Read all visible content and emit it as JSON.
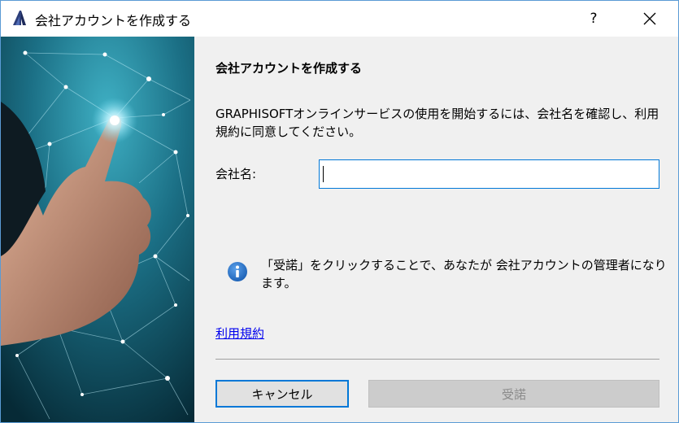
{
  "window": {
    "title": "会社アカウントを作成する",
    "help_label": "?",
    "close_label": "×"
  },
  "dialog": {
    "heading": "会社アカウントを作成する",
    "description": "GRAPHISOFTオンラインサービスの使用を開始するには、会社名を確認し、利用規約に同意してください。",
    "company_label": "会社名:",
    "company_value": "",
    "info_text": "「受諾」をクリックすることで、あなたが 会社アカウントの管理者になります。",
    "terms_link": "利用規約",
    "cancel_label": "キャンセル",
    "accept_label": "受諾"
  },
  "colors": {
    "accent": "#0078d7",
    "info_blue": "#1a5fb4",
    "link": "#0000ee"
  }
}
